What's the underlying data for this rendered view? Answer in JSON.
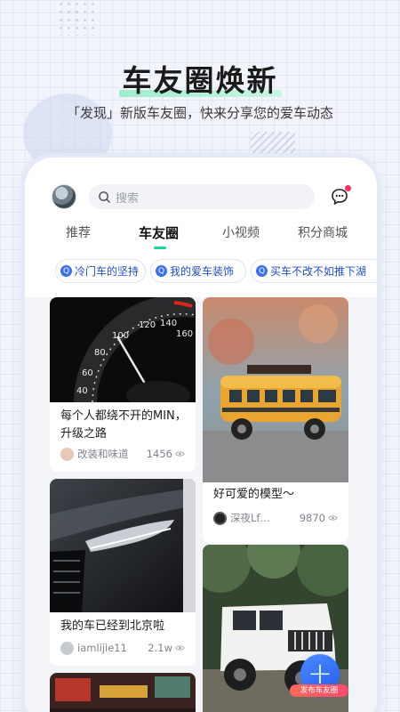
{
  "headline": "车友圈焕新",
  "subtitle": "「发现」新版车友圈，快来分享您的爱车动态",
  "search": {
    "placeholder": "搜索"
  },
  "tabs": [
    {
      "label": "推荐",
      "active": false
    },
    {
      "label": "车友圈",
      "active": true
    },
    {
      "label": "小视频",
      "active": false
    },
    {
      "label": "积分商城",
      "active": false
    }
  ],
  "chips": [
    {
      "label": "冷门车的坚持"
    },
    {
      "label": "我的爱车装饰"
    },
    {
      "label": "买车不改不如推下湖"
    }
  ],
  "posts": [
    {
      "title": "每个人都绕不开的MIN，升级之路",
      "user": "改装和味道",
      "views": "1456",
      "image": "speedometer-photo"
    },
    {
      "title": "好可爱的模型～",
      "user": "深夜Lf…",
      "views": "9870",
      "image": "toy-bus-photo"
    },
    {
      "title": "我的车已经到北京啦",
      "user": "iamlijie11",
      "views": "2.1w",
      "image": "audi-headlight-photo"
    },
    {
      "title": "",
      "user": "",
      "views": "",
      "image": "jeep-wrangler-photo"
    },
    {
      "title": "",
      "user": "",
      "views": "",
      "image": "street-night-photo"
    }
  ],
  "fab": {
    "label": "发布车友圈",
    "icon": "plus-icon"
  },
  "colors": {
    "accent": "#1bd49e",
    "chip_text": "#1f4fc9",
    "fab": "#2f6ff5",
    "badge": "#ff2f5c"
  }
}
